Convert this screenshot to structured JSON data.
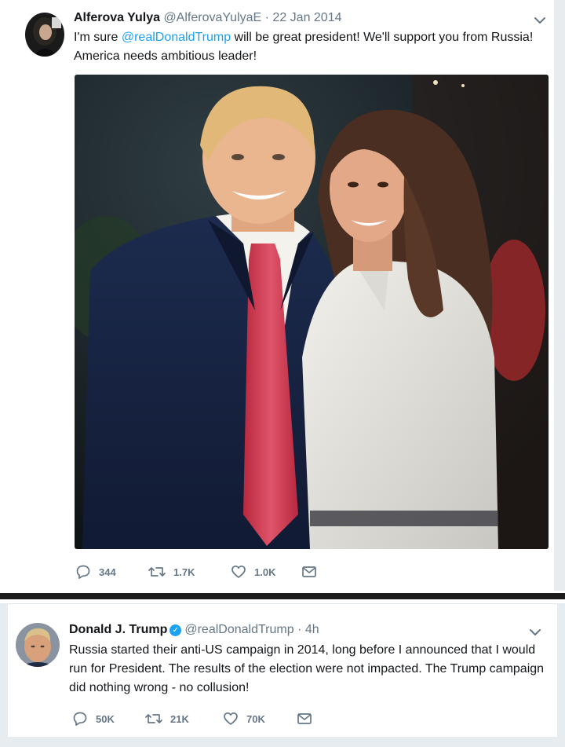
{
  "tweet1": {
    "author_name": "Alferova Yulya",
    "handle": "@AlferovaYulyaE",
    "separator": "·",
    "date": "22 Jan 2014",
    "text_before": "I'm sure ",
    "mention": "@realDonaldTrump",
    "text_after": " will be great president! We'll support you from Russia! America needs ambitious leader!",
    "replies": "344",
    "retweets": "1.7K",
    "likes": "1.0K"
  },
  "tweet2": {
    "author_name": "Donald J. Trump",
    "handle": "@realDonaldTrump",
    "separator": "·",
    "time": "4h",
    "text": "Russia started their anti-US campaign in 2014, long before I announced that I would run for President. The results of the election were not impacted. The Trump campaign did nothing wrong - no collusion!",
    "replies": "50K",
    "retweets": "21K",
    "likes": "70K"
  },
  "icons": {
    "reply": "reply-icon",
    "retweet": "retweet-icon",
    "like": "heart-icon",
    "message": "envelope-icon",
    "caret": "chevron-down-icon",
    "verified": "verified-badge-icon"
  },
  "colors": {
    "link": "#1da1f2",
    "text": "#14171a",
    "secondary": "#657786",
    "background": "#e6ecf0"
  }
}
